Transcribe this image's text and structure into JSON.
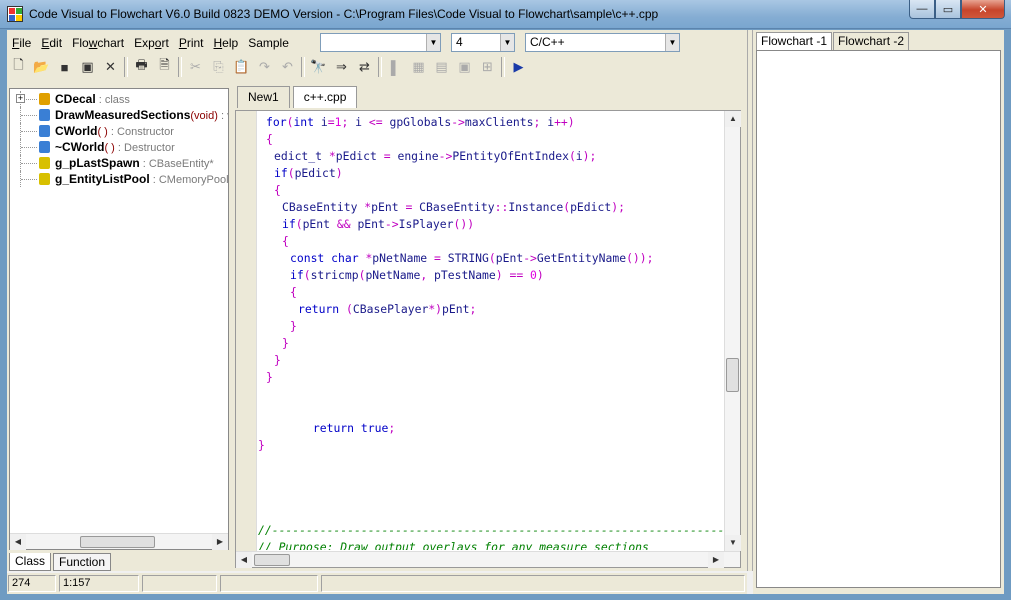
{
  "window": {
    "title": "Code Visual to Flowchart V6.0 Build 0823 DEMO Version - C:\\Program Files\\Code Visual to Flowchart\\sample\\c++.cpp",
    "controls": {
      "minimize": "—",
      "maximize": "▭",
      "close": "✕"
    }
  },
  "menu": {
    "items": [
      {
        "key": "file",
        "label": "File",
        "ul": "F",
        "rest": "ile"
      },
      {
        "key": "edit",
        "label": "Edit",
        "ul": "E",
        "rest": "dit"
      },
      {
        "key": "flowchart",
        "label": "Flowchart",
        "pre": "Flo",
        "ul": "w",
        "rest": "chart"
      },
      {
        "key": "export",
        "label": "Export",
        "pre": "Exp",
        "ul": "o",
        "rest": "rt"
      },
      {
        "key": "print",
        "label": "Print",
        "ul": "P",
        "rest": "rint"
      },
      {
        "key": "help",
        "label": "Help",
        "ul": "H",
        "rest": "elp"
      },
      {
        "key": "sample",
        "label": "Sample"
      }
    ]
  },
  "combos": {
    "search": "",
    "tab_size": "4",
    "language": "C/C++",
    "arrow": "▼"
  },
  "toolbar": {
    "icons": [
      "new-file-icon",
      "open-folder-icon",
      "save-icon",
      "save-all-icon",
      "close-file-icon",
      "print-icon",
      "print-preview-icon",
      "cut-icon",
      "copy-icon",
      "paste-icon",
      "redo-icon",
      "undo-icon",
      "find-icon",
      "find-next-icon",
      "replace-icon",
      "bookmark-icon",
      "clear-icon",
      "option-icon",
      "view-icon",
      "grid-icon",
      "run-icon"
    ],
    "glyphs": [
      "🗋",
      "📂",
      "■",
      "▣",
      "✕",
      "🖶",
      "🗎",
      "✂",
      "⎘",
      "📋",
      "↷",
      "↶",
      "🔭",
      "⇒",
      "⇄",
      "▌",
      "▦",
      "▤",
      "▣",
      "⊞",
      "▶"
    ]
  },
  "tree": {
    "items": [
      {
        "name": "CDecal",
        "sig": "",
        "desc": " : class",
        "icon": "class-icon",
        "color": "#e0a000",
        "expandable": true
      },
      {
        "name": "DrawMeasuredSections",
        "sig": "(void)",
        "desc": " : v",
        "icon": "method-icon",
        "color": "#3a7fd5",
        "expandable": false
      },
      {
        "name": "CWorld",
        "sig": "( )",
        "desc": " : Constructor",
        "icon": "method-icon",
        "color": "#3a7fd5",
        "expandable": false
      },
      {
        "name": "~CWorld",
        "sig": "( )",
        "desc": " : Destructor",
        "icon": "method-icon",
        "color": "#3a7fd5",
        "expandable": false
      },
      {
        "name": "g_pLastSpawn",
        "sig": "",
        "desc": " : CBaseEntity*",
        "icon": "variable-icon",
        "color": "#d8c000",
        "expandable": false
      },
      {
        "name": "g_EntityListPool",
        "sig": "",
        "desc": " : CMemoryPool",
        "icon": "variable-icon",
        "color": "#d8c000",
        "expandable": false
      }
    ]
  },
  "bottom_tabs": {
    "class": "Class",
    "function": "Function"
  },
  "editor": {
    "tabs": [
      {
        "label": "New1",
        "active": false
      },
      {
        "label": "c++.cpp",
        "active": true
      }
    ]
  },
  "code": {
    "lines": [
      {
        "indent": 1,
        "tokens": [
          [
            "kw",
            "for"
          ],
          [
            "op",
            "("
          ],
          [
            "kw",
            "int "
          ],
          [
            "id",
            "i"
          ],
          [
            "op",
            "="
          ],
          [
            "num",
            "1"
          ],
          [
            "op",
            ";"
          ],
          [
            "id",
            " i "
          ],
          [
            "op",
            "<="
          ],
          [
            "id",
            " gpGlobals"
          ],
          [
            "op",
            "->"
          ],
          [
            "id",
            "maxClients"
          ],
          [
            "op",
            ";"
          ],
          [
            "id",
            " i"
          ],
          [
            "op",
            "++)"
          ]
        ]
      },
      {
        "indent": 1,
        "tokens": [
          [
            "op",
            "{"
          ]
        ]
      },
      {
        "indent": 2,
        "tokens": [
          [
            "id",
            "edict_t "
          ],
          [
            "op",
            "*"
          ],
          [
            "id",
            "pEdict "
          ],
          [
            "op",
            "="
          ],
          [
            "id",
            " engine"
          ],
          [
            "op",
            "->"
          ],
          [
            "id",
            "PEntityOfEntIndex"
          ],
          [
            "op",
            "("
          ],
          [
            "id",
            "i"
          ],
          [
            "op",
            ");"
          ]
        ]
      },
      {
        "indent": 2,
        "tokens": [
          [
            "kw",
            "if"
          ],
          [
            "op",
            "("
          ],
          [
            "id",
            "pEdict"
          ],
          [
            "op",
            ")"
          ]
        ]
      },
      {
        "indent": 2,
        "tokens": [
          [
            "op",
            "{"
          ]
        ]
      },
      {
        "indent": 3,
        "tokens": [
          [
            "id",
            "CBaseEntity "
          ],
          [
            "op",
            "*"
          ],
          [
            "id",
            "pEnt "
          ],
          [
            "op",
            "="
          ],
          [
            "id",
            " CBaseEntity"
          ],
          [
            "op",
            "::"
          ],
          [
            "id",
            "Instance"
          ],
          [
            "op",
            "("
          ],
          [
            "id",
            "pEdict"
          ],
          [
            "op",
            ");"
          ]
        ]
      },
      {
        "indent": 3,
        "tokens": [
          [
            "kw",
            "if"
          ],
          [
            "op",
            "("
          ],
          [
            "id",
            "pEnt "
          ],
          [
            "op",
            "&&"
          ],
          [
            "id",
            " pEnt"
          ],
          [
            "op",
            "->"
          ],
          [
            "id",
            "IsPlayer"
          ],
          [
            "op",
            "())"
          ]
        ]
      },
      {
        "indent": 3,
        "tokens": [
          [
            "op",
            "{"
          ]
        ]
      },
      {
        "indent": 4,
        "tokens": [
          [
            "kw",
            "const char "
          ],
          [
            "op",
            "*"
          ],
          [
            "id",
            "pNetName "
          ],
          [
            "op",
            "="
          ],
          [
            "id",
            " STRING"
          ],
          [
            "op",
            "("
          ],
          [
            "id",
            "pEnt"
          ],
          [
            "op",
            "->"
          ],
          [
            "id",
            "GetEntityName"
          ],
          [
            "op",
            "());"
          ]
        ]
      },
      {
        "indent": 4,
        "tokens": [
          [
            "kw",
            "if"
          ],
          [
            "op",
            "("
          ],
          [
            "id",
            "stricmp"
          ],
          [
            "op",
            "("
          ],
          [
            "id",
            "pNetName"
          ],
          [
            "op",
            ","
          ],
          [
            "id",
            " pTestName"
          ],
          [
            "op",
            ") =="
          ],
          [
            "num",
            " 0"
          ],
          [
            "op",
            ")"
          ]
        ]
      },
      {
        "indent": 4,
        "tokens": [
          [
            "op",
            "{"
          ]
        ]
      },
      {
        "indent": 5,
        "tokens": [
          [
            "kw",
            "return "
          ],
          [
            "op",
            "("
          ],
          [
            "id",
            "CBasePlayer"
          ],
          [
            "op",
            "*)"
          ],
          [
            "id",
            "pEnt"
          ],
          [
            "op",
            ";"
          ]
        ]
      },
      {
        "indent": 4,
        "tokens": [
          [
            "op",
            "}"
          ]
        ]
      },
      {
        "indent": 3,
        "tokens": [
          [
            "op",
            "}"
          ]
        ]
      },
      {
        "indent": 2,
        "tokens": [
          [
            "op",
            "}"
          ]
        ]
      },
      {
        "indent": 1,
        "tokens": [
          [
            "op",
            "}"
          ]
        ]
      },
      {
        "indent": 0,
        "tokens": []
      },
      {
        "indent": 0,
        "tokens": []
      },
      {
        "indent": 0,
        "tokens": [
          [
            "id",
            "        "
          ],
          [
            "kw",
            "return true"
          ],
          [
            "op",
            ";"
          ]
        ]
      },
      {
        "indent": 0,
        "tokens": [
          [
            "op",
            "}"
          ]
        ]
      },
      {
        "indent": 0,
        "tokens": []
      },
      {
        "indent": 0,
        "tokens": []
      },
      {
        "indent": 0,
        "tokens": []
      },
      {
        "indent": 0,
        "tokens": []
      },
      {
        "indent": 0,
        "tokens": [
          [
            "cm",
            "//-----------------------------------------------------------------------"
          ]
        ]
      },
      {
        "indent": 0,
        "tokens": [
          [
            "cm",
            "// Purpose: Draw output overlays for any measure sections"
          ]
        ]
      }
    ]
  },
  "flowchart": {
    "tabs": [
      {
        "label": "Flowchart -1",
        "active": true
      },
      {
        "label": "Flowchart -2",
        "active": false
      }
    ]
  },
  "status": {
    "line": "274",
    "position": "1:157"
  },
  "colors": {
    "keyword": "#0000c8",
    "operator": "#c000c0",
    "identifier": "#1a1a8a",
    "comment": "#008000"
  }
}
